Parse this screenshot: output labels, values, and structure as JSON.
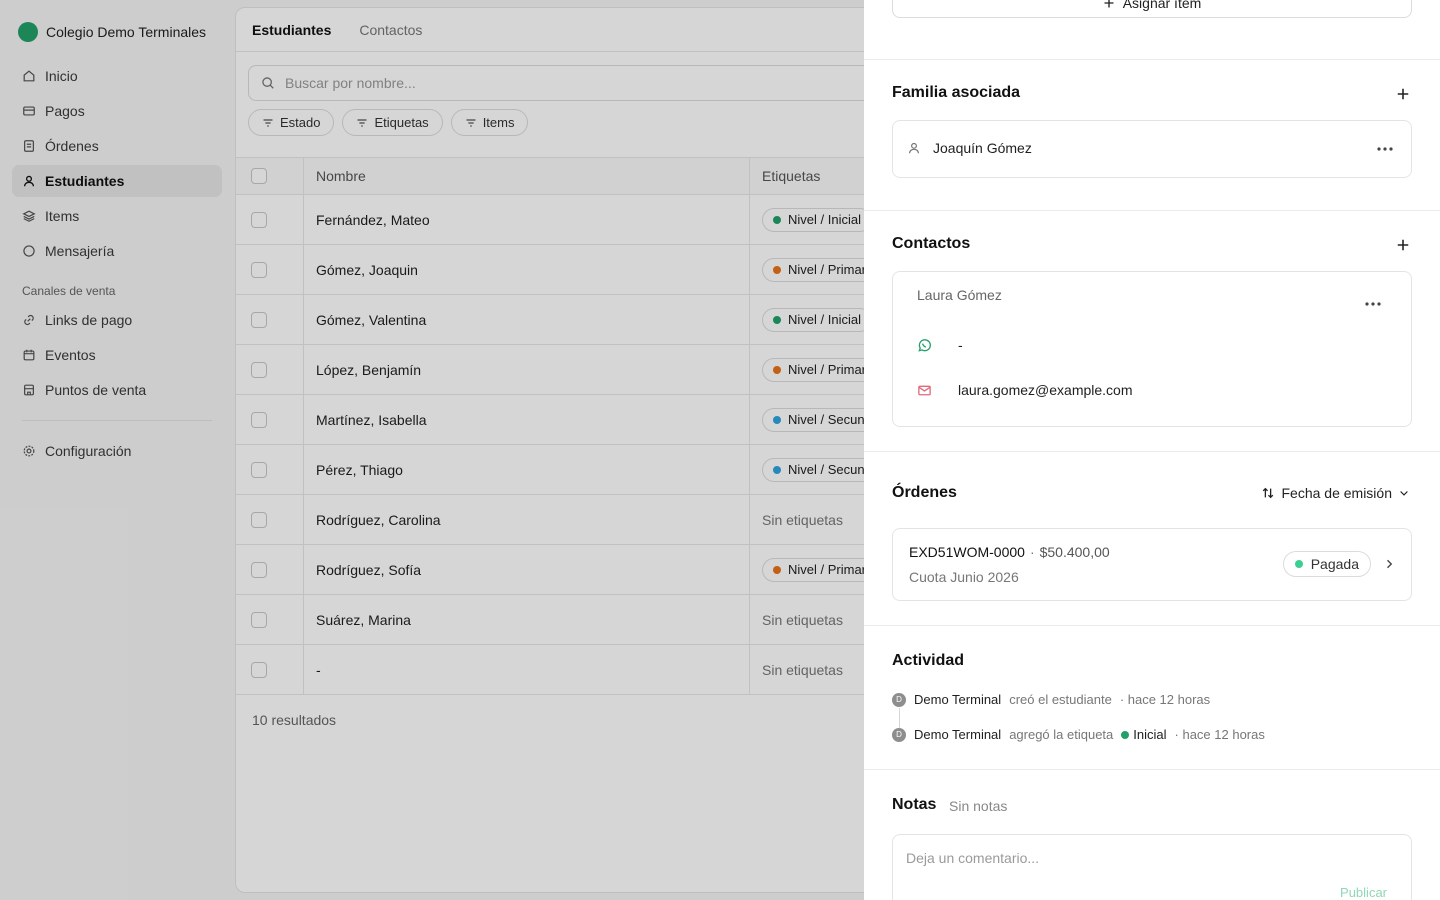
{
  "sidebar": {
    "org_name": "Colegio Demo Terminales",
    "items": [
      {
        "label": "Inicio",
        "icon": "home-icon"
      },
      {
        "label": "Pagos",
        "icon": "card-icon"
      },
      {
        "label": "Órdenes",
        "icon": "document-icon"
      },
      {
        "label": "Estudiantes",
        "icon": "user-icon",
        "active": true
      },
      {
        "label": "Items",
        "icon": "layers-icon"
      },
      {
        "label": "Mensajería",
        "icon": "chat-icon"
      }
    ],
    "section_label": "Canales de venta",
    "channels": [
      {
        "label": "Links de pago",
        "icon": "link-icon"
      },
      {
        "label": "Eventos",
        "icon": "calendar-icon"
      },
      {
        "label": "Puntos de venta",
        "icon": "store-icon"
      }
    ],
    "settings_label": "Configuración"
  },
  "main": {
    "tabs": [
      "Estudiantes",
      "Contactos"
    ],
    "search_placeholder": "Buscar por nombre...",
    "filters": [
      "Estado",
      "Etiquetas",
      "Items"
    ],
    "columns": [
      "Nombre",
      "Etiquetas"
    ],
    "rows": [
      {
        "name": "Fernández, Mateo",
        "tag": "Nivel / Inicial",
        "color": "#22a06b"
      },
      {
        "name": "Gómez, Joaquin",
        "tag": "Nivel / Primaria",
        "color": "#e8731a"
      },
      {
        "name": "Gómez, Valentina",
        "tag": "Nivel / Inicial",
        "color": "#22a06b"
      },
      {
        "name": "López, Benjamín",
        "tag": "Nivel / Primaria",
        "color": "#e8731a"
      },
      {
        "name": "Martínez, Isabella",
        "tag": "Nivel / Secundaria",
        "color": "#2fa3e0"
      },
      {
        "name": "Pérez, Thiago",
        "tag": "Nivel / Secundaria",
        "color": "#2fa3e0"
      },
      {
        "name": "Rodríguez, Carolina",
        "tag": "",
        "color": ""
      },
      {
        "name": "Rodríguez, Sofía",
        "tag": "Nivel / Primaria",
        "color": "#e8731a"
      },
      {
        "name": "Suárez, Marina",
        "tag": "",
        "color": ""
      },
      {
        "name": "-",
        "tag": "",
        "color": ""
      }
    ],
    "no_tags_label": "Sin etiquetas",
    "results": "10 resultados"
  },
  "panel": {
    "assign_label": "Asignar ítem",
    "family": {
      "title": "Familia asociada",
      "name": "Joaquín Gómez"
    },
    "contacts": {
      "title": "Contactos",
      "name": "Laura Gómez",
      "whatsapp": "-",
      "email": "laura.gomez@example.com"
    },
    "orders": {
      "title": "Órdenes",
      "sort_label": "Fecha de emisión",
      "order_id": "EXD51WOM-0000",
      "separator": "·",
      "amount": "$50.400,00",
      "description": "Cuota Junio 2026",
      "status": "Pagada"
    },
    "activity": {
      "title": "Actividad",
      "events": [
        {
          "avatar": "D",
          "who": "Demo Terminal",
          "action": "creó el estudiante",
          "tag": "",
          "time": "· hace 12 horas"
        },
        {
          "avatar": "D",
          "who": "Demo Terminal",
          "action": "agregó la etiqueta",
          "tag": "Inicial",
          "time": "· hace 12 horas"
        }
      ]
    },
    "notes": {
      "title": "Notas",
      "empty": "Sin notas",
      "placeholder": "Deja un comentario...",
      "publish": "Publicar"
    }
  },
  "colors": {
    "accent": "#22a06b",
    "orange": "#e8731a",
    "blue": "#2fa3e0"
  }
}
